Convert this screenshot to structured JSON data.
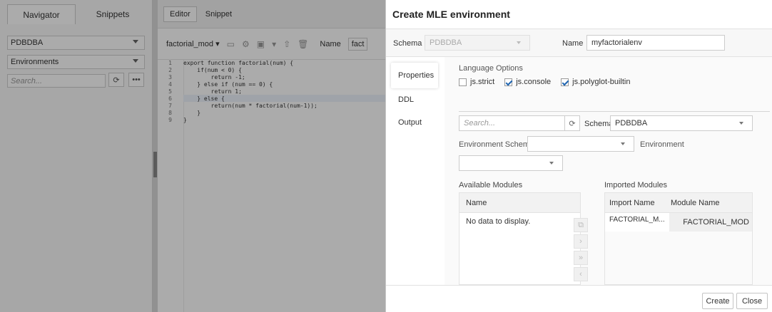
{
  "background": {
    "navigator_tabs": [
      "Navigator",
      "Snippets"
    ],
    "schema_select": "PDBDBA",
    "object_select": "Environments",
    "search_placeholder": "Search...",
    "editor_tabs": [
      "Editor",
      "Snippet"
    ],
    "module_select": "factorial_mod",
    "name_label": "Name",
    "name_value": "fact",
    "code": {
      "line_numbers": [
        "1",
        "2",
        "3",
        "4",
        "5",
        "6",
        "7",
        "8",
        "9"
      ],
      "lines": [
        "export function factorial(num) {",
        "    if(num < 0) {",
        "        return -1;",
        "    } else if (num == 0) {",
        "        return 1;",
        "    } else {",
        "        return(num * factorial(num-1));",
        "    }",
        "}"
      ]
    }
  },
  "dialog": {
    "title": "Create MLE environment",
    "schema_label": "Schema",
    "schema_value": "PDBDBA",
    "name_label": "Name",
    "name_value": "myfactorialenv",
    "nav_items": [
      "Properties",
      "DDL",
      "Output"
    ],
    "language_options_label": "Language Options",
    "options": [
      {
        "label": "js.strict",
        "checked": false
      },
      {
        "label": "js.console",
        "checked": true
      },
      {
        "label": "js.polyglot-builtin",
        "checked": true
      }
    ],
    "search_placeholder": "Search...",
    "filter_schema_label": "Schema",
    "filter_schema_value": "PDBDBA",
    "env_schema_label": "Environment Schema",
    "environment_label": "Environment",
    "available_modules_label": "Available Modules",
    "available_col": "Name",
    "no_data": "No data to display.",
    "imported_modules_label": "Imported Modules",
    "imported_cols": [
      "Import Name",
      "Module Name"
    ],
    "imported_rows": [
      {
        "import_name": "FACTORIAL_M...",
        "module_name": "FACTORIAL_MOD"
      }
    ],
    "create_button": "Create",
    "close_button": "Close"
  }
}
